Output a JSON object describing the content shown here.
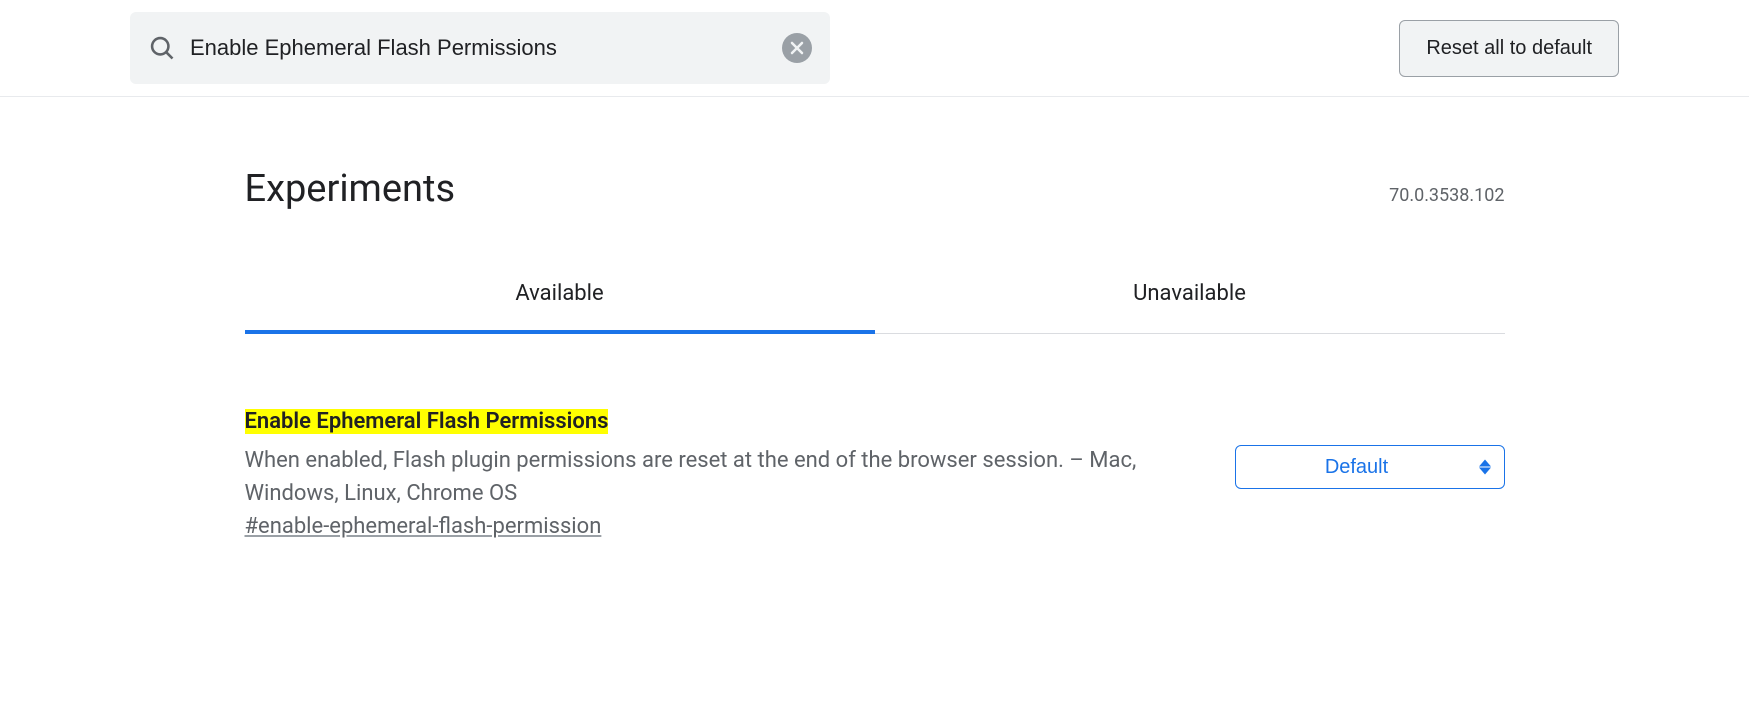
{
  "header": {
    "search_value": "Enable Ephemeral Flash Permissions",
    "reset_label": "Reset all to default"
  },
  "page": {
    "title": "Experiments",
    "version": "70.0.3538.102"
  },
  "tabs": {
    "available": "Available",
    "unavailable": "Unavailable"
  },
  "flag": {
    "title": "Enable Ephemeral Flash Permissions",
    "description": "When enabled, Flash plugin permissions are reset at the end of the browser session. – Mac, Windows, Linux, Chrome OS",
    "anchor": "#enable-ephemeral-flash-permission",
    "select_value": "Default"
  }
}
